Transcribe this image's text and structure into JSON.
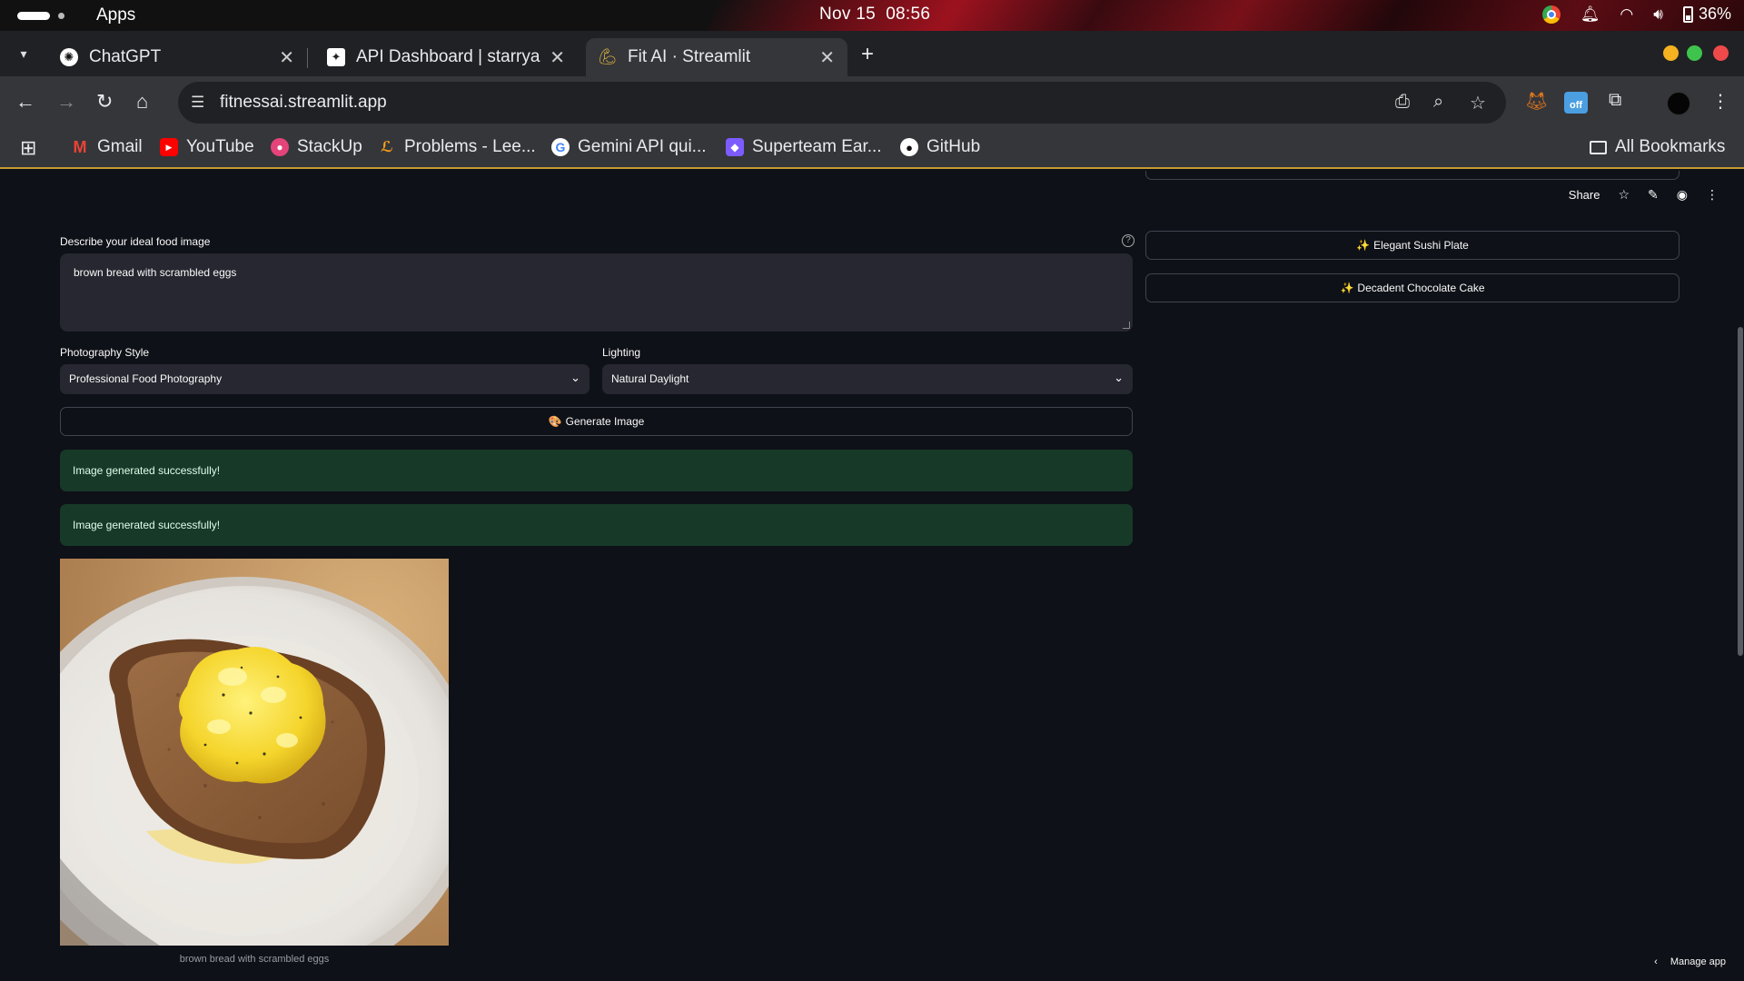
{
  "os": {
    "apps_label": "Apps",
    "date": "Nov 15",
    "time": "08:56",
    "battery": "36%",
    "icons": [
      "chrome-icon",
      "notification-icon",
      "wifi-icon",
      "volume-icon",
      "battery-icon"
    ]
  },
  "tabs": [
    {
      "title": "ChatGPT",
      "icon": "chatgpt-icon"
    },
    {
      "title": "API Dashboard | starryai",
      "icon": "starryai-icon"
    },
    {
      "title": "Fit AI · Streamlit",
      "icon": "flexed-biceps-icon",
      "active": true
    }
  ],
  "toolbar": {
    "url": "fitnessai.streamlit.app",
    "ext_badge": "off"
  },
  "bookmarks": [
    {
      "label": "Gmail",
      "icon": "gmail-icon",
      "color": "#ea4335"
    },
    {
      "label": "YouTube",
      "icon": "youtube-icon",
      "color": "#ff0000"
    },
    {
      "label": "StackUp",
      "icon": "stackup-icon",
      "color": "#e4447a"
    },
    {
      "label": "Problems - Lee...",
      "icon": "leetcode-icon",
      "color": "#ffa116"
    },
    {
      "label": "Gemini API qui...",
      "icon": "google-icon",
      "color": "#4285f4"
    },
    {
      "label": "Superteam Ear...",
      "icon": "superteam-icon",
      "color": "#7c5cff"
    },
    {
      "label": "GitHub",
      "icon": "github-icon",
      "color": "#ffffff"
    }
  ],
  "all_bookmarks": "All Bookmarks",
  "app": {
    "header": {
      "share": "Share"
    },
    "prompt": {
      "label": "Describe your ideal food image",
      "value": "brown bread with scrambled eggs"
    },
    "style": {
      "label": "Photography Style",
      "value": "Professional Food Photography"
    },
    "lighting": {
      "label": "Lighting",
      "value": "Natural Daylight"
    },
    "generate_button": "Generate Image",
    "generate_icon": "🎨",
    "alerts": [
      "Image generated successfully!",
      "Image generated successfully!"
    ],
    "image_caption": "brown bread with scrambled eggs",
    "examples": [
      {
        "label": "Elegant Sushi Plate",
        "icon": "✨"
      },
      {
        "label": "Decadent Chocolate Cake",
        "icon": "✨"
      }
    ],
    "manage_app": "Manage app"
  },
  "colors": {
    "background": "#0e1117",
    "input_bg": "#262730",
    "success_bg": "#173928",
    "bookmark_underline": "#c79a33"
  }
}
